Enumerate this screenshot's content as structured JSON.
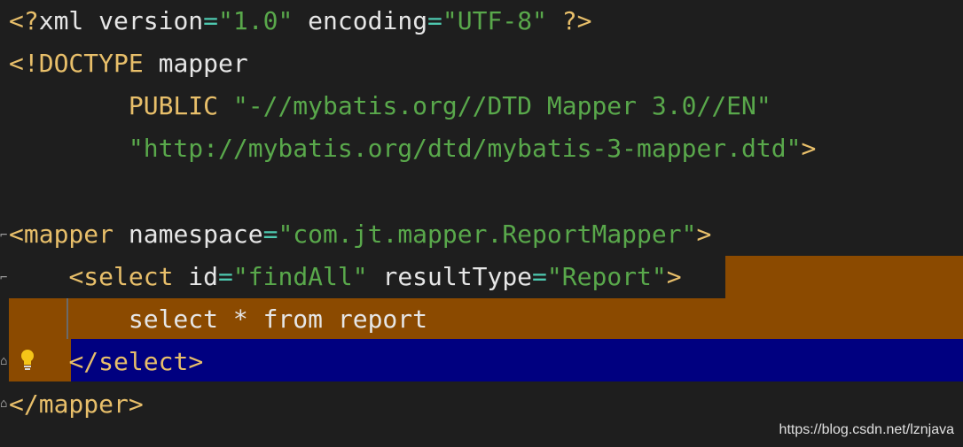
{
  "editor": {
    "lines": [
      {
        "parts": [
          {
            "t": "<?",
            "c": "punct"
          },
          {
            "t": "xml ",
            "c": "plain"
          },
          {
            "t": "version",
            "c": "plain"
          },
          {
            "t": "=",
            "c": "eq"
          },
          {
            "t": "\"1.0\"",
            "c": "str"
          },
          {
            "t": " encoding",
            "c": "plain"
          },
          {
            "t": "=",
            "c": "eq"
          },
          {
            "t": "\"UTF-8\"",
            "c": "str"
          },
          {
            "t": " ?>",
            "c": "punct"
          }
        ]
      },
      {
        "parts": [
          {
            "t": "<!",
            "c": "punct"
          },
          {
            "t": "DOCTYPE",
            "c": "kw"
          },
          {
            "t": " mapper",
            "c": "plain"
          }
        ]
      },
      {
        "parts": [
          {
            "t": "        PUBLIC ",
            "c": "kw"
          },
          {
            "t": "\"-//mybatis.org//DTD Mapper 3.0//EN\"",
            "c": "str"
          }
        ]
      },
      {
        "parts": [
          {
            "t": "        ",
            "c": "plain"
          },
          {
            "t": "\"http://mybatis.org/dtd/mybatis-3-mapper.dtd\"",
            "c": "str"
          },
          {
            "t": ">",
            "c": "punct"
          }
        ]
      },
      {
        "parts": []
      },
      {
        "parts": [
          {
            "t": "<",
            "c": "punct"
          },
          {
            "t": "mapper",
            "c": "tag"
          },
          {
            "t": " namespace",
            "c": "plain"
          },
          {
            "t": "=",
            "c": "eq"
          },
          {
            "t": "\"com.jt.mapper.ReportMapper\"",
            "c": "str"
          },
          {
            "t": ">",
            "c": "punct"
          }
        ]
      },
      {
        "parts": [
          {
            "t": "    ",
            "c": "plain"
          },
          {
            "t": "<",
            "c": "punct"
          },
          {
            "t": "select",
            "c": "tag"
          },
          {
            "t": " id",
            "c": "plain"
          },
          {
            "t": "=",
            "c": "eq"
          },
          {
            "t": "\"findAll\"",
            "c": "str"
          },
          {
            "t": " resultType",
            "c": "plain"
          },
          {
            "t": "=",
            "c": "eq"
          },
          {
            "t": "\"Report\"",
            "c": "str"
          },
          {
            "t": ">",
            "c": "punct"
          }
        ]
      },
      {
        "parts": [
          {
            "t": "        select * from report",
            "c": "plain"
          }
        ]
      },
      {
        "parts": [
          {
            "t": "    ",
            "c": "plain"
          },
          {
            "t": "</",
            "c": "punct"
          },
          {
            "t": "select",
            "c": "tag"
          },
          {
            "t": ">",
            "c": "punct"
          }
        ]
      },
      {
        "parts": [
          {
            "t": "</",
            "c": "punct"
          },
          {
            "t": "mapper",
            "c": "tag"
          },
          {
            "t": ">",
            "c": "punct"
          }
        ]
      }
    ]
  },
  "watermark": "https://blog.csdn.net/lznjava",
  "colors": {
    "background": "#1e1e1e",
    "highlight_orange": "#8b4a00",
    "highlight_blue": "#000080",
    "tag": "#e8bf6a",
    "string": "#59a84b"
  },
  "icons": {
    "intention": "lightbulb-icon",
    "fold": "fold-marker-icon"
  }
}
